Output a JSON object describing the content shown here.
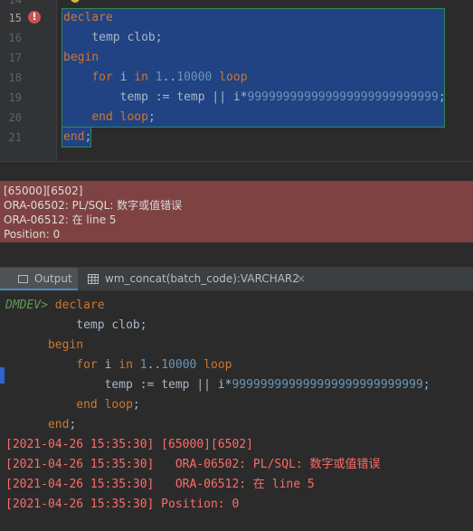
{
  "editor": {
    "line_numbers": [
      "14",
      "15",
      "16",
      "17",
      "18",
      "19",
      "20",
      "21"
    ],
    "current_line": "15",
    "code": [
      {
        "kw1": "declare"
      },
      {
        "indent": "    ",
        "text": "temp clob;"
      },
      {
        "kw1": "begin"
      },
      {
        "indent": "    ",
        "kw1": "for",
        "text1": " i ",
        "kw2": "in",
        "num1": " 1",
        "op": "..",
        "num2": "10000",
        "kw3": " loop"
      },
      {
        "indent": "        ",
        "text": "temp := temp || i*",
        "num": "999999999999999999999999999",
        "tail": ";"
      },
      {
        "indent": "    ",
        "kw1": "end loop",
        "tail": ";"
      },
      {
        "kw1": "end",
        "tail": ";"
      }
    ]
  },
  "error_panel": {
    "lines": [
      "[65000][6502]",
      "ORA-06502: PL/SQL: 数字或值错误",
      "ORA-06512: 在 line 5",
      "Position: 0"
    ]
  },
  "tabs": {
    "output_label": "Output",
    "result_label": "wm_concat(batch_code):VARCHAR2",
    "close_glyph": "×"
  },
  "output": {
    "prompt": "DMDEV>",
    "echo": [
      {
        "prefix": " ",
        "kw1": "declare"
      },
      {
        "prefix": "          ",
        "text": "temp clob;"
      },
      {
        "prefix": "      ",
        "kw1": "begin"
      },
      {
        "prefix": "          ",
        "kw1": "for",
        "text1": " i ",
        "kw2": "in",
        "num1": " 1",
        "op": "..",
        "num2": "10000",
        "kw3": " loop"
      },
      {
        "prefix": "              ",
        "text": "temp := temp || i*",
        "num": "999999999999999999999999999",
        "tail": ";"
      },
      {
        "prefix": "          ",
        "kw1": "end loop",
        "tail": ";"
      },
      {
        "prefix": "      ",
        "kw1": "end",
        "tail": ";"
      }
    ],
    "log": [
      "[2021-04-26 15:35:30] [65000][6502]",
      "[2021-04-26 15:35:30]   ORA-06502: PL/SQL: 数字或值错误",
      "[2021-04-26 15:35:30]   ORA-06512: 在 line 5",
      "[2021-04-26 15:35:30] Position: 0"
    ]
  },
  "colors": {
    "keyword": "#cc7832",
    "number": "#6897bb",
    "selection": "#214283",
    "error_panel": "#7f4242",
    "log_error": "#ff6b68",
    "prompt": "#629755"
  }
}
